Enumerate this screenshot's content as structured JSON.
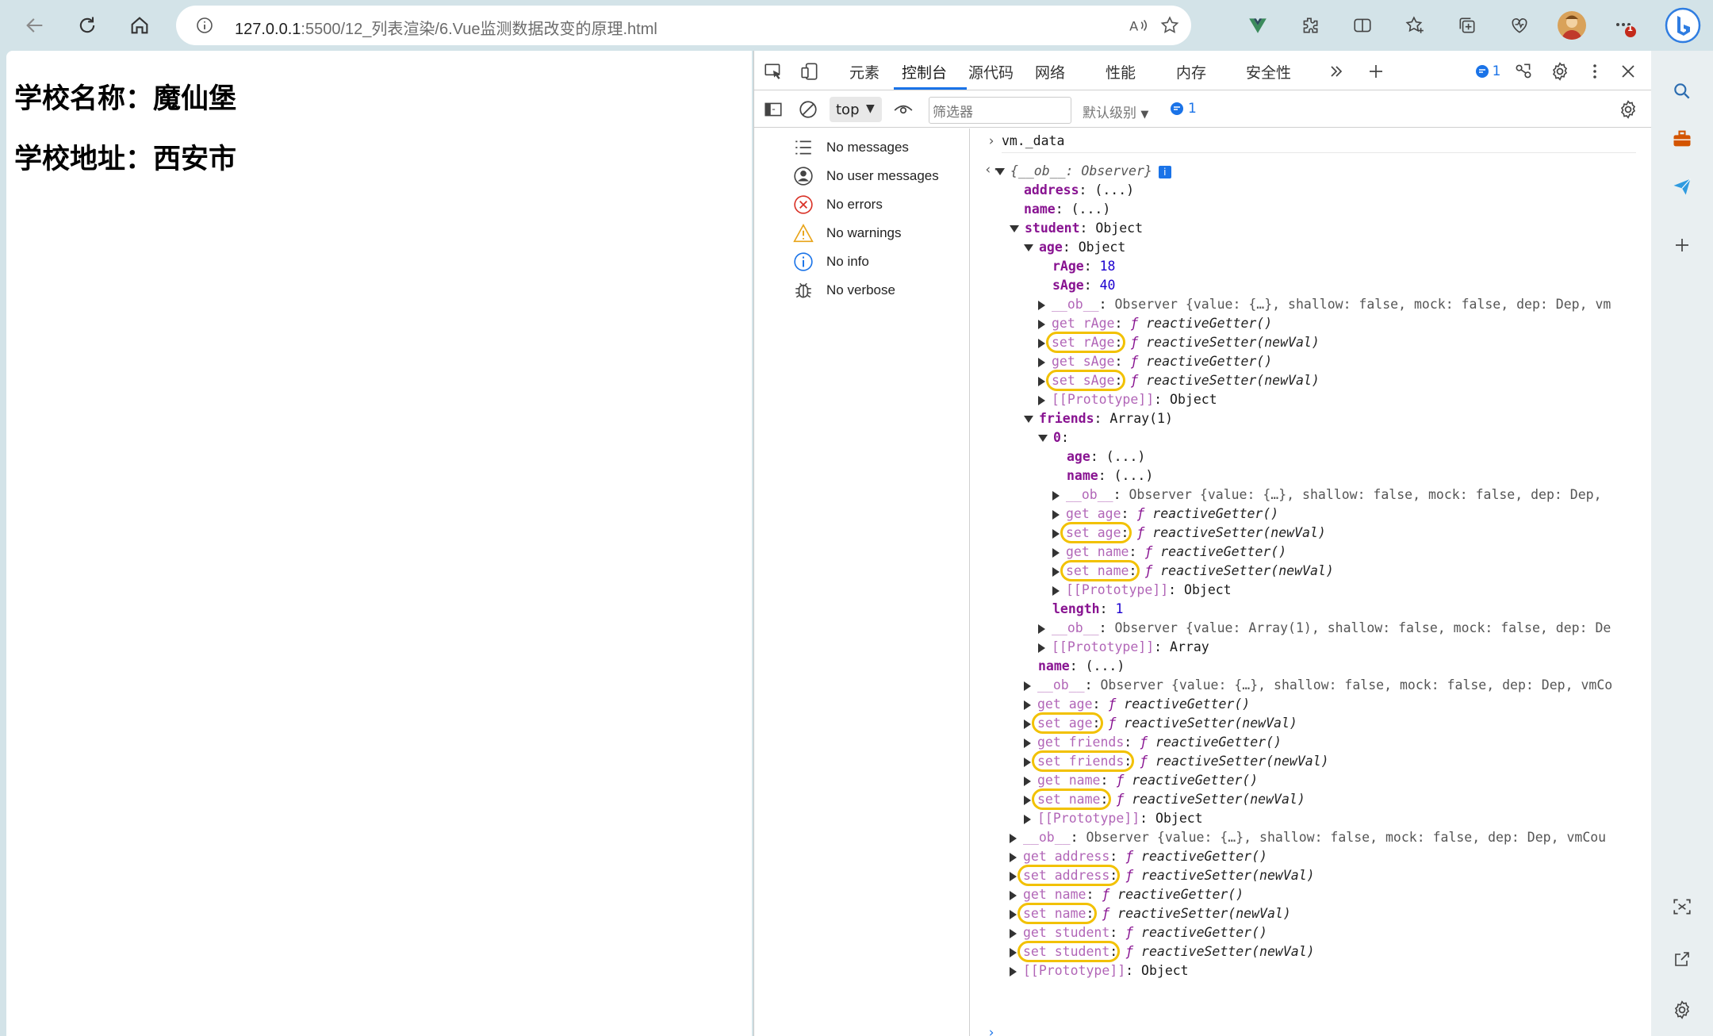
{
  "browser": {
    "url_host": "127.0.0.1",
    "url_path": ":5500/12_列表渲染/6.Vue监测数据改变的原理.html",
    "notification_count": "1"
  },
  "page": {
    "line1": "学校名称：魔仙堡",
    "line2": "学校地址：西安市"
  },
  "devtools": {
    "tabs": [
      "元素",
      "控制台",
      "源代码",
      "网络",
      "性能",
      "内存",
      "安全性"
    ],
    "active_tab": "控制台",
    "issue_count": "1",
    "context": "top",
    "filter_placeholder": "筛选器",
    "level": "默认级别",
    "msg_count": "1"
  },
  "sidebar": {
    "items": [
      {
        "label": "No messages",
        "icon": "list-icon"
      },
      {
        "label": "No user messages",
        "icon": "user-icon"
      },
      {
        "label": "No errors",
        "icon": "error-icon"
      },
      {
        "label": "No warnings",
        "icon": "warning-icon"
      },
      {
        "label": "No info",
        "icon": "info-icon"
      },
      {
        "label": "No verbose",
        "icon": "bug-icon"
      }
    ]
  },
  "console": {
    "input": "vm._data",
    "lines": [
      {
        "indent": 0,
        "arrow": "down",
        "key": "{__ob__: Observer}",
        "sep": "",
        "val": "",
        "style": "obj",
        "info": true
      },
      {
        "indent": 1,
        "arrow": "",
        "key": "address",
        "sep": ": ",
        "val": "(...)",
        "style": "k"
      },
      {
        "indent": 1,
        "arrow": "",
        "key": "name",
        "sep": ": ",
        "val": "(...)",
        "style": "k"
      },
      {
        "indent": 1,
        "arrow": "down",
        "key": "student",
        "sep": ": ",
        "val": "Object",
        "style": "k"
      },
      {
        "indent": 2,
        "arrow": "down",
        "key": "age",
        "sep": ": ",
        "val": "Object",
        "style": "k"
      },
      {
        "indent": 3,
        "arrow": "",
        "key": "rAge",
        "sep": ": ",
        "val": "18",
        "style": "num"
      },
      {
        "indent": 3,
        "arrow": "",
        "key": "sAge",
        "sep": ": ",
        "val": "40",
        "style": "num"
      },
      {
        "indent": 3,
        "arrow": "right",
        "key": "__ob__",
        "sep": ": ",
        "val": "Observer {value: {…}, shallow: false, mock: false, dep: Dep, vm",
        "style": "ob"
      },
      {
        "indent": 3,
        "arrow": "right",
        "key": "get rAge",
        "sep": ": ",
        "val": "reactiveGetter()",
        "style": "fn"
      },
      {
        "indent": 3,
        "arrow": "right",
        "key": "set rAge",
        "sep": ": ",
        "val": "reactiveSetter(newVal)",
        "style": "fn"
      },
      {
        "indent": 3,
        "arrow": "right",
        "key": "get sAge",
        "sep": ": ",
        "val": "reactiveGetter()",
        "style": "fn"
      },
      {
        "indent": 3,
        "arrow": "right",
        "key": "set sAge",
        "sep": ": ",
        "val": "reactiveSetter(newVal)",
        "style": "fn"
      },
      {
        "indent": 3,
        "arrow": "right",
        "key": "[[Prototype]]",
        "sep": ": ",
        "val": "Object",
        "style": "proto"
      },
      {
        "indent": 2,
        "arrow": "down",
        "key": "friends",
        "sep": ": ",
        "val": "Array(1)",
        "style": "k"
      },
      {
        "indent": 3,
        "arrow": "down",
        "key": "0",
        "sep": ":",
        "val": "",
        "style": "k"
      },
      {
        "indent": 4,
        "arrow": "",
        "key": "age",
        "sep": ": ",
        "val": "(...)",
        "style": "k"
      },
      {
        "indent": 4,
        "arrow": "",
        "key": "name",
        "sep": ": ",
        "val": "(...)",
        "style": "k"
      },
      {
        "indent": 4,
        "arrow": "right",
        "key": "__ob__",
        "sep": ": ",
        "val": "Observer {value: {…}, shallow: false, mock: false, dep: Dep,",
        "style": "ob"
      },
      {
        "indent": 4,
        "arrow": "right",
        "key": "get age",
        "sep": ": ",
        "val": "reactiveGetter()",
        "style": "fn"
      },
      {
        "indent": 4,
        "arrow": "right",
        "key": "set age",
        "sep": ": ",
        "val": "reactiveSetter(newVal)",
        "style": "fn"
      },
      {
        "indent": 4,
        "arrow": "right",
        "key": "get name",
        "sep": ": ",
        "val": "reactiveGetter()",
        "style": "fn"
      },
      {
        "indent": 4,
        "arrow": "right",
        "key": "set name",
        "sep": ": ",
        "val": "reactiveSetter(newVal)",
        "style": "fn"
      },
      {
        "indent": 4,
        "arrow": "right",
        "key": "[[Prototype]]",
        "sep": ": ",
        "val": "Object",
        "style": "proto"
      },
      {
        "indent": 3,
        "arrow": "",
        "key": "length",
        "sep": ": ",
        "val": "1",
        "style": "num"
      },
      {
        "indent": 3,
        "arrow": "right",
        "key": "__ob__",
        "sep": ": ",
        "val": "Observer {value: Array(1), shallow: false, mock: false, dep: De",
        "style": "ob"
      },
      {
        "indent": 3,
        "arrow": "right",
        "key": "[[Prototype]]",
        "sep": ": ",
        "val": "Array",
        "style": "proto"
      },
      {
        "indent": 2,
        "arrow": "",
        "key": "name",
        "sep": ": ",
        "val": "(...)",
        "style": "k"
      },
      {
        "indent": 2,
        "arrow": "right",
        "key": "__ob__",
        "sep": ": ",
        "val": "Observer {value: {…}, shallow: false, mock: false, dep: Dep, vmCo",
        "style": "ob"
      },
      {
        "indent": 2,
        "arrow": "right",
        "key": "get age",
        "sep": ": ",
        "val": "reactiveGetter()",
        "style": "fn"
      },
      {
        "indent": 2,
        "arrow": "right",
        "key": "set age",
        "sep": ": ",
        "val": "reactiveSetter(newVal)",
        "style": "fn"
      },
      {
        "indent": 2,
        "arrow": "right",
        "key": "get friends",
        "sep": ": ",
        "val": "reactiveGetter()",
        "style": "fn"
      },
      {
        "indent": 2,
        "arrow": "right",
        "key": "set friends",
        "sep": ": ",
        "val": "reactiveSetter(newVal)",
        "style": "fn"
      },
      {
        "indent": 2,
        "arrow": "right",
        "key": "get name",
        "sep": ": ",
        "val": "reactiveGetter()",
        "style": "fn"
      },
      {
        "indent": 2,
        "arrow": "right",
        "key": "set name",
        "sep": ": ",
        "val": "reactiveSetter(newVal)",
        "style": "fn"
      },
      {
        "indent": 2,
        "arrow": "right",
        "key": "[[Prototype]]",
        "sep": ": ",
        "val": "Object",
        "style": "proto"
      },
      {
        "indent": 1,
        "arrow": "right",
        "key": "__ob__",
        "sep": ": ",
        "val": "Observer {value: {…}, shallow: false, mock: false, dep: Dep, vmCou",
        "style": "ob"
      },
      {
        "indent": 1,
        "arrow": "right",
        "key": "get address",
        "sep": ": ",
        "val": "reactiveGetter()",
        "style": "fn"
      },
      {
        "indent": 1,
        "arrow": "right",
        "key": "set address",
        "sep": ": ",
        "val": "reactiveSetter(newVal)",
        "style": "fn"
      },
      {
        "indent": 1,
        "arrow": "right",
        "key": "get name",
        "sep": ": ",
        "val": "reactiveGetter()",
        "style": "fn"
      },
      {
        "indent": 1,
        "arrow": "right",
        "key": "set name",
        "sep": ": ",
        "val": "reactiveSetter(newVal)",
        "style": "fn"
      },
      {
        "indent": 1,
        "arrow": "right",
        "key": "get student",
        "sep": ": ",
        "val": "reactiveGetter()",
        "style": "fn"
      },
      {
        "indent": 1,
        "arrow": "right",
        "key": "set student",
        "sep": ": ",
        "val": "reactiveSetter(newVal)",
        "style": "fn"
      },
      {
        "indent": 1,
        "arrow": "right",
        "key": "[[Prototype]]",
        "sep": ": ",
        "val": "Object",
        "style": "proto"
      }
    ],
    "highlight_color": "#f2c100"
  },
  "colors": {
    "key": "#881391",
    "number": "#1c00cf",
    "boolean": "#0d22aa",
    "highlight": "#f2c100",
    "accent": "#1a73e8"
  }
}
